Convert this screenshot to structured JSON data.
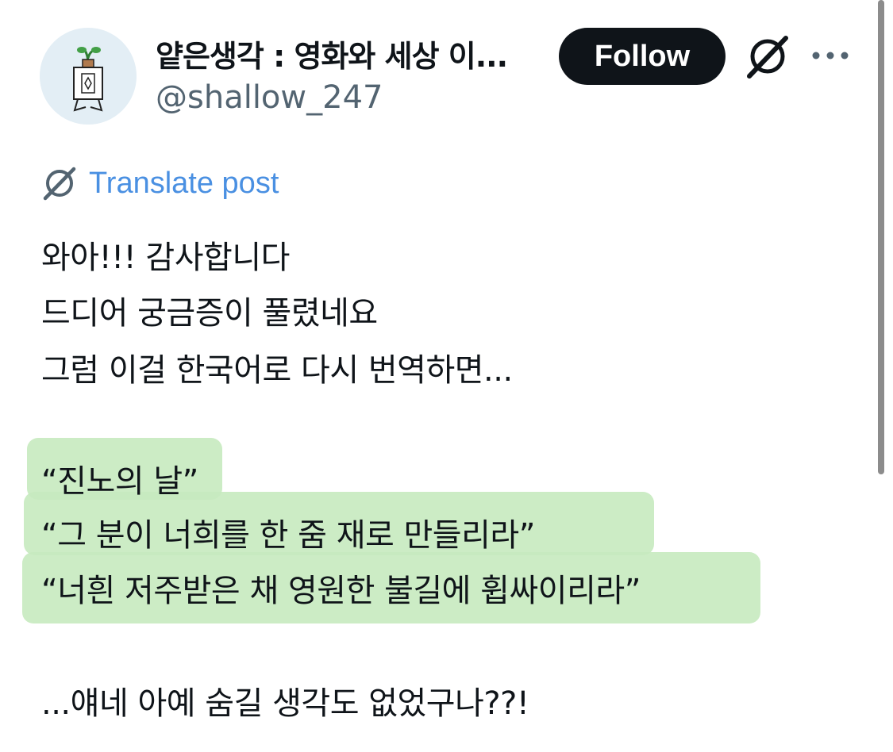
{
  "author": {
    "display_name": "얕은생각 : 영화와 세상 이...",
    "handle": "@shallow_247"
  },
  "actions": {
    "follow_label": "Follow",
    "grok_icon": "grok-icon",
    "more_icon": "more-icon"
  },
  "translate": {
    "label": "Translate post",
    "icon": "translate-icon"
  },
  "post": {
    "lines": [
      "와아!!! 감사합니다",
      "드디어 궁금증이 풀렸네요",
      "그럼 이걸 한국어로 다시 번역하면...",
      "“진노의 날”",
      "“그 분이 너희를 한 줌 재로 만들리라”",
      "“너흰 저주받은 채 영원한 불길에 휩싸이리라”",
      "...얘네 아예 숨길 생각도 없었구나??!"
    ]
  },
  "colors": {
    "follow_bg": "#0f1419",
    "link": "#4a90e2",
    "highlight": "#c6eabf"
  }
}
